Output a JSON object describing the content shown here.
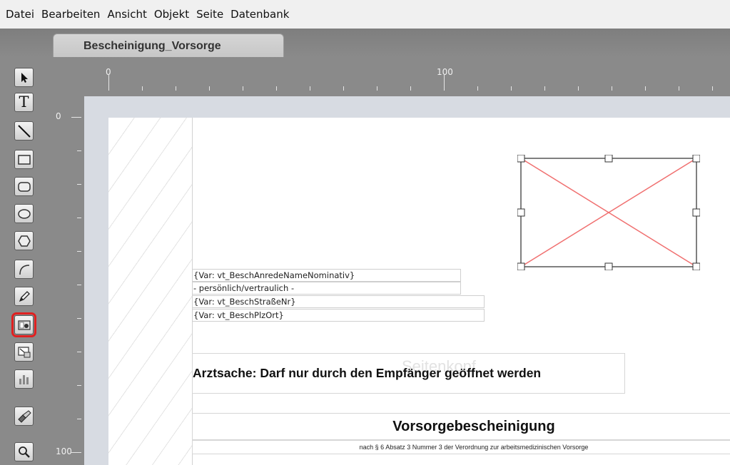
{
  "menu": [
    "Datei",
    "Bearbeiten",
    "Ansicht",
    "Objekt",
    "Seite",
    "Datenbank"
  ],
  "tab": {
    "label": "Bescheinigung_Vorsorge"
  },
  "ruler": {
    "h_labels": [
      "0",
      "100"
    ],
    "v_labels": [
      "0",
      "100"
    ]
  },
  "tools": [
    {
      "name": "select-tool",
      "icon": "arrow-icon"
    },
    {
      "name": "text-tool",
      "icon": "text-icon"
    },
    {
      "name": "line-tool",
      "icon": "line-icon"
    },
    {
      "name": "rectangle-tool",
      "icon": "rectangle-icon"
    },
    {
      "name": "rounded-rectangle-tool",
      "icon": "rounded-rectangle-icon"
    },
    {
      "name": "ellipse-tool",
      "icon": "ellipse-icon"
    },
    {
      "name": "polygon-tool",
      "icon": "hexagon-icon"
    },
    {
      "name": "arc-tool",
      "icon": "arc-icon"
    },
    {
      "name": "pen-tool",
      "icon": "pencil-icon"
    },
    {
      "name": "image-tool",
      "icon": "camera-icon",
      "highlighted": true
    },
    {
      "name": "embed-tool",
      "icon": "frame-icon"
    },
    {
      "name": "chart-tool",
      "icon": "bar-chart-icon"
    },
    {
      "name": "brush-tool",
      "icon": "brush-icon"
    },
    {
      "name": "zoom-tool",
      "icon": "magnifier-icon"
    }
  ],
  "highlight_color": "#e02020",
  "document": {
    "address_fields": [
      "{Var: vt_BeschAnredeNameNominativ}",
      "- persönlich/vertraulich -",
      "{Var: vt_BeschStraßeNr}",
      "{Var: vt_BeschPlzOrt}"
    ],
    "watermark": "Seitenkopf",
    "notice": "Arztsache: Darf nur durch den Empfänger geöffnet werden",
    "title": "Vorsorgebescheinigung",
    "subtitle": "nach § 6 Absatz 3 Nummer 3 der Verordnung zur arbeitsmedizinischen Vorsorge"
  }
}
